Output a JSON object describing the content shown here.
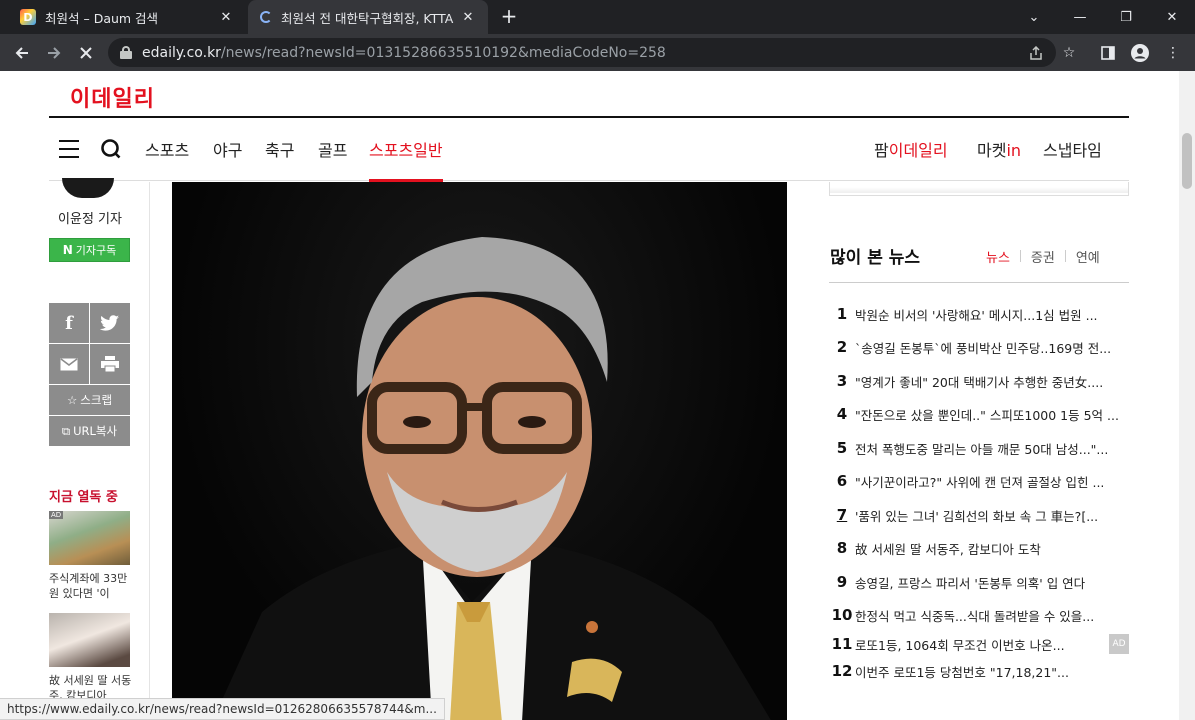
{
  "browser": {
    "tabs": [
      {
        "title": "최원석 – Daum 검색",
        "favicon": "daum-icon"
      },
      {
        "title": "최원석 전 대한탁구협회장, KTTA",
        "favicon": "loading-spinner-icon"
      }
    ],
    "url_host": "edaily.co.kr",
    "url_path": "/news/read?newsId=01315286635510192&mediaCodeNo=258"
  },
  "site": {
    "logo": "이데일리",
    "nav": [
      "스포츠",
      "야구",
      "축구",
      "골프",
      "스포츠일반"
    ],
    "nav_active": "스포츠일반",
    "nav_right": {
      "pam_prefix": "팜",
      "pam_suffix": "이데일리",
      "market_prefix": "마켓",
      "market_suffix": "in",
      "snap": "스냅타임"
    }
  },
  "left_rail": {
    "reporter": "이윤정 기자",
    "subscribe_logo": "N",
    "subscribe": "기자구독",
    "scrap": "스크랩",
    "url_copy": "URL복사",
    "hot_title": "지금 열독 중",
    "hot_items": [
      {
        "text": "주식계좌에 33만원 있다면 '이",
        "ad": "AD"
      },
      {
        "text": "故 서세원 딸 서동주, 캄보디아"
      }
    ]
  },
  "ranking": {
    "title": "많이 본 뉴스",
    "tabs": [
      "뉴스",
      "증권",
      "연예"
    ],
    "active_tab": "뉴스",
    "items": [
      {
        "num": "1",
        "text": "박원순 비서의 '사랑해요' 메시지...1심 법원 ..."
      },
      {
        "num": "2",
        "text": "`송영길 돈봉투`에 풍비박산 민주당..169명 전..."
      },
      {
        "num": "3",
        "text": "\"영계가 좋네\" 20대 택배기사 추행한 중년女...."
      },
      {
        "num": "4",
        "text": "\"잔돈으로 샀을 뿐인데..\" 스피또1000 1등 5억 ..."
      },
      {
        "num": "5",
        "text": "전처 폭행도중 말리는 아들 깨문 50대 남성...\"..."
      },
      {
        "num": "6",
        "text": "\"사기꾼이라고?\" 사위에 캔 던져 골절상 입힌 ..."
      },
      {
        "num": "7",
        "text": "'품위 있는 그녀' 김희선의 화보 속 그 車는?[..."
      },
      {
        "num": "8",
        "text": "故 서세원 딸 서동주, 캄보디아 도착"
      },
      {
        "num": "9",
        "text": "송영길, 프랑스 파리서 '돈봉투 의혹' 입 연다"
      },
      {
        "num": "10",
        "text": "한정식 먹고 식중독...식대 돌려받을 수 있을..."
      },
      {
        "num": "11",
        "text": "로또1등, 1064회 무조건 이번호 나온...",
        "ad": "AD"
      },
      {
        "num": "12",
        "text": "이번주 로또1등 당첨번호 \"17,18,21\"..."
      }
    ]
  },
  "status_url": "https://www.edaily.co.kr/news/read?newsId=01262806635578744&m...",
  "colors": {
    "brand_red": "#e3111f",
    "naver_green": "#3bb54a",
    "chrome_dark": "#202124"
  }
}
